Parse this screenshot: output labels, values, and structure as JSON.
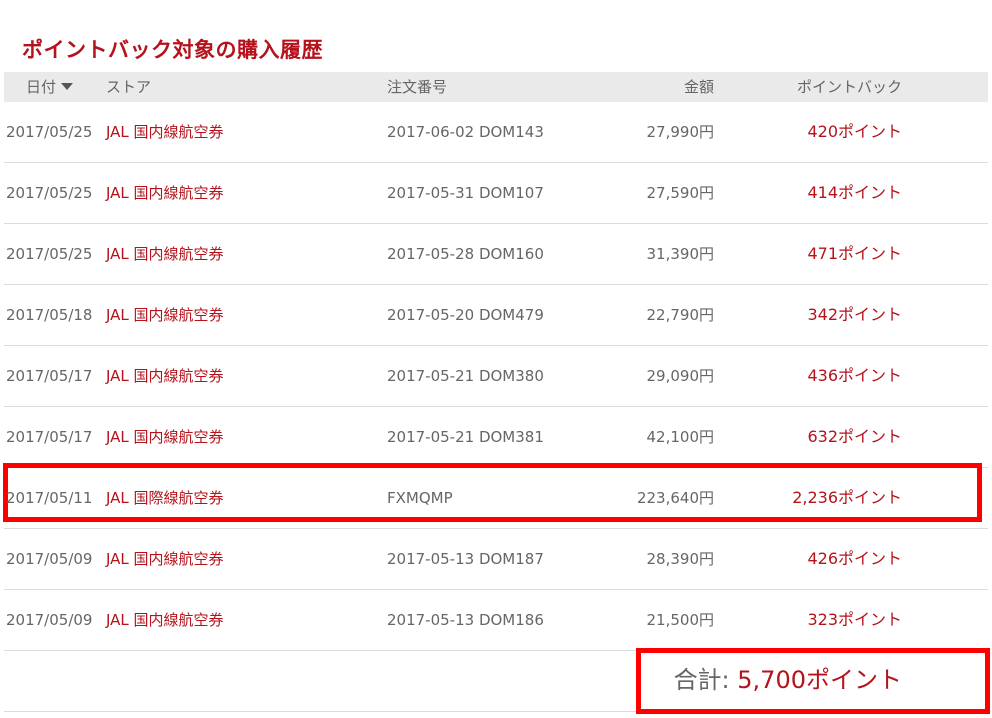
{
  "page_title": "ポイントバック対象の購入履歴",
  "headers": {
    "date": "日付",
    "store": "ストア",
    "order": "注文番号",
    "amount": "金額",
    "points": "ポイントバック"
  },
  "rows": [
    {
      "date": "2017/05/25",
      "store": "JAL 国内線航空券",
      "order": "2017-06-02 DOM143",
      "amount": "27,990円",
      "points": "420ポイント"
    },
    {
      "date": "2017/05/25",
      "store": "JAL 国内線航空券",
      "order": "2017-05-31 DOM107",
      "amount": "27,590円",
      "points": "414ポイント"
    },
    {
      "date": "2017/05/25",
      "store": "JAL 国内線航空券",
      "order": "2017-05-28 DOM160",
      "amount": "31,390円",
      "points": "471ポイント"
    },
    {
      "date": "2017/05/18",
      "store": "JAL 国内線航空券",
      "order": "2017-05-20 DOM479",
      "amount": "22,790円",
      "points": "342ポイント"
    },
    {
      "date": "2017/05/17",
      "store": "JAL 国内線航空券",
      "order": "2017-05-21 DOM380",
      "amount": "29,090円",
      "points": "436ポイント"
    },
    {
      "date": "2017/05/17",
      "store": "JAL 国内線航空券",
      "order": "2017-05-21 DOM381",
      "amount": "42,100円",
      "points": "632ポイント"
    },
    {
      "date": "2017/05/11",
      "store": "JAL 国際線航空券",
      "order": "FXMQMP",
      "amount": "223,640円",
      "points": "2,236ポイント"
    },
    {
      "date": "2017/05/09",
      "store": "JAL 国内線航空券",
      "order": "2017-05-13 DOM187",
      "amount": "28,390円",
      "points": "426ポイント"
    },
    {
      "date": "2017/05/09",
      "store": "JAL 国内線航空券",
      "order": "2017-05-13 DOM186",
      "amount": "21,500円",
      "points": "323ポイント"
    }
  ],
  "total": {
    "label": "合計: ",
    "value": "5,700ポイント"
  },
  "colors": {
    "accent": "#b5121b",
    "highlight_box": "#ff0000",
    "header_bg": "#eaeaea"
  },
  "icons": {
    "sort": "caret-down-icon"
  }
}
